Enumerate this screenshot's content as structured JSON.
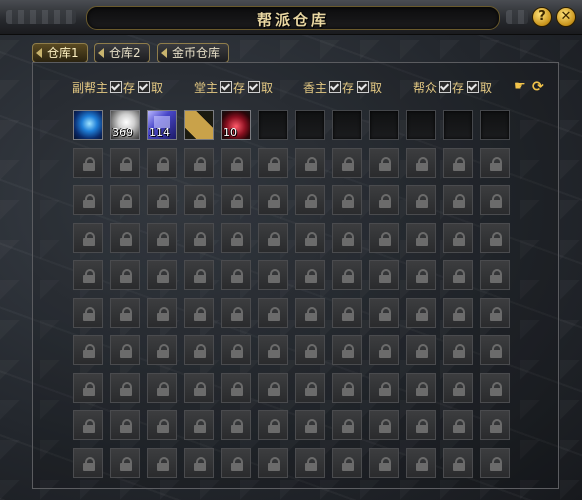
{
  "window": {
    "title": "帮派仓库",
    "help_label": "?",
    "close_label": "✕"
  },
  "tabs": [
    {
      "label": "仓库1",
      "active": true
    },
    {
      "label": "仓库2",
      "active": false
    },
    {
      "label": "金币仓库",
      "active": false
    }
  ],
  "permissions": [
    {
      "role": "副帮主",
      "deposit": "存",
      "withdraw": "取",
      "deposit_checked": true,
      "withdraw_checked": true
    },
    {
      "role": "堂主",
      "deposit": "存",
      "withdraw": "取",
      "deposit_checked": true,
      "withdraw_checked": true
    },
    {
      "role": "香主",
      "deposit": "存",
      "withdraw": "取",
      "deposit_checked": true,
      "withdraw_checked": true
    },
    {
      "role": "帮众",
      "deposit": "存",
      "withdraw": "取",
      "deposit_checked": true,
      "withdraw_checked": true
    }
  ],
  "tools": {
    "hand_icon": "hand-pointer-icon",
    "refresh_icon": "refresh-icon"
  },
  "grid": {
    "columns": 12,
    "rows": 10,
    "unlocked_slots": 12,
    "items": [
      {
        "slot": 0,
        "kind": "blue-orb-item",
        "qty": ""
      },
      {
        "slot": 1,
        "kind": "silver-ore-item",
        "qty": "369"
      },
      {
        "slot": 2,
        "kind": "blue-crystal-item",
        "qty": "114"
      },
      {
        "slot": 3,
        "kind": "scroll-item",
        "qty": ""
      },
      {
        "slot": 4,
        "kind": "red-potion-item",
        "qty": "10"
      }
    ]
  }
}
